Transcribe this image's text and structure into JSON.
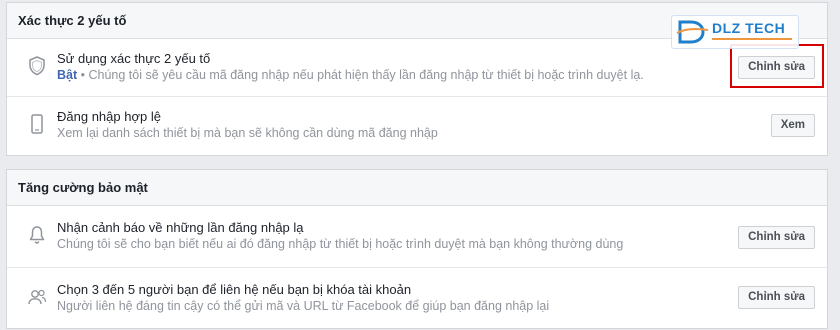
{
  "sections": [
    {
      "title": "Xác thực 2 yếu tố",
      "rows": [
        {
          "icon": "shield-icon",
          "title": "Sử dụng xác thực 2 yếu tố",
          "status": "Bật",
          "description": " • Chúng tôi sẽ yêu cầu mã đăng nhập nếu phát hiện thấy lần đăng nhập từ thiết bị hoặc trình duyệt lạ.",
          "button": "Chỉnh sửa"
        },
        {
          "icon": "phone-icon",
          "title": "Đăng nhập hợp lệ",
          "description": "Xem lại danh sách thiết bị mà bạn sẽ không cần dùng mã đăng nhập",
          "button": "Xem"
        }
      ]
    },
    {
      "title": "Tăng cường bảo mật",
      "rows": [
        {
          "icon": "bell-icon",
          "title": "Nhận cảnh báo về những lần đăng nhập lạ",
          "description": "Chúng tôi sẽ cho bạn biết nếu ai đó đăng nhập từ thiết bị hoặc trình duyệt mà bạn không thường dùng",
          "button": "Chỉnh sửa"
        },
        {
          "icon": "friends-icon",
          "title": "Chọn 3 đến 5 người bạn để liên hệ nếu bạn bị khóa tài khoản",
          "description": "Người liên hệ đáng tin cậy có thể gửi mã và URL từ Facebook để giúp bạn đăng nhập lại",
          "button": "Chỉnh sửa"
        }
      ]
    }
  ],
  "watermark": {
    "text": "DLZ TECH",
    "brand_color": "#0a72c8",
    "accent_color": "#f08c2a"
  },
  "highlight_color": "#d60000",
  "link_color": "#4267b2"
}
